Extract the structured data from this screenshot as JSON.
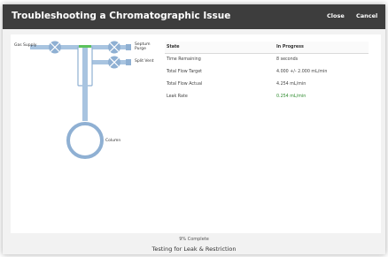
{
  "dialog": {
    "title": "Troubleshooting a Chromatographic Issue",
    "close_label": "Close",
    "cancel_label": "Cancel"
  },
  "diagram": {
    "labels": {
      "gas_supply": "Gas Supply",
      "septum_purge": "Septum Purge",
      "split_vent": "Split Vent",
      "column": "Column"
    },
    "colors": {
      "pipe": "#a8c4e0",
      "valve": "#8fb0d3",
      "indicator": "#5cc25c"
    }
  },
  "status_table": {
    "headers": [
      "State",
      "In Progress"
    ],
    "rows": [
      {
        "label": "Time Remaining",
        "value": "8 seconds"
      },
      {
        "label": "Total Flow Target",
        "value": "4.000 +/- 2.000 mL/min"
      },
      {
        "label": "Total Flow Actual",
        "value": "4.254 mL/min"
      },
      {
        "label": "Leak Rate",
        "value": "0.254 mL/min",
        "color": "#2e8b2e"
      }
    ]
  },
  "progress": {
    "percent_text": "9% Complete",
    "status_text": "Testing for Leak & Restriction"
  }
}
